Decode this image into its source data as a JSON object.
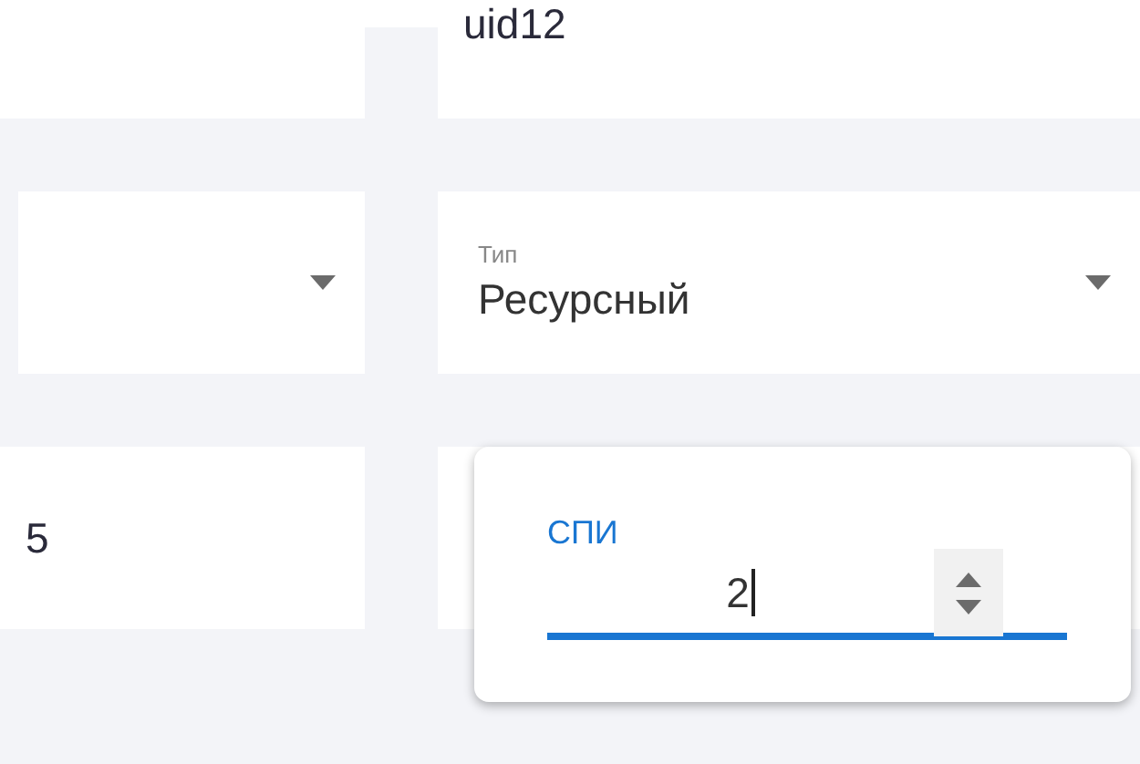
{
  "uid_field": {
    "value": "uid12"
  },
  "type_select": {
    "label": "Тип",
    "value": "Ресурсный"
  },
  "number_field": {
    "value": "5"
  },
  "spi_field": {
    "label": "СПИ",
    "value": "2",
    "focused": true
  }
}
